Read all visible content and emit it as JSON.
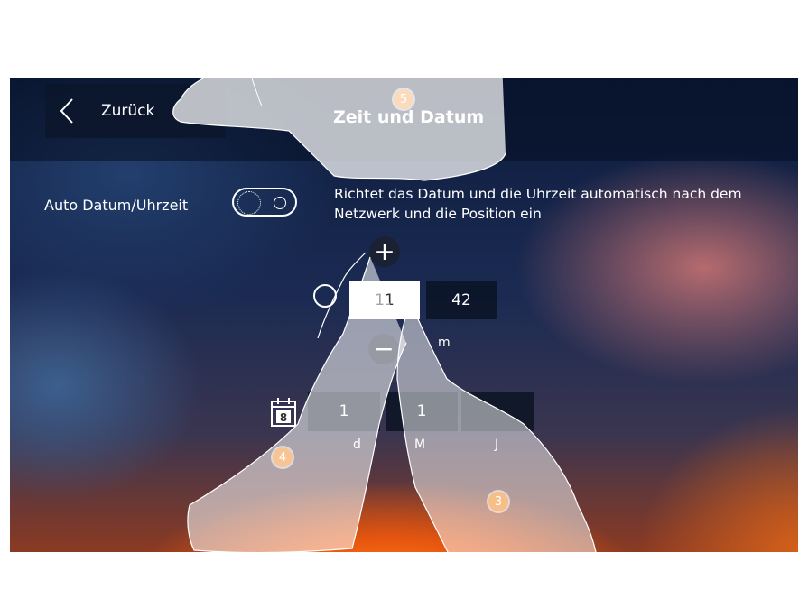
{
  "header": {
    "back_label": "Zurück",
    "title": "Zeit und Datum"
  },
  "auto": {
    "label": "Auto Datum/Uhrzeit",
    "description": "Richtet das Datum und die Uhrzeit automatisch nach dem Netzwerk und die Position ein"
  },
  "time": {
    "plus": "+",
    "minus": "−",
    "hour": "11",
    "minute": "42",
    "unit_label": "m"
  },
  "date": {
    "day": "1",
    "month": "1",
    "year": "",
    "day_label": "d",
    "month_label": "M",
    "year_label": "J",
    "calendar_day": "8"
  },
  "callouts": {
    "five": "5",
    "four": "4",
    "three": "3"
  }
}
